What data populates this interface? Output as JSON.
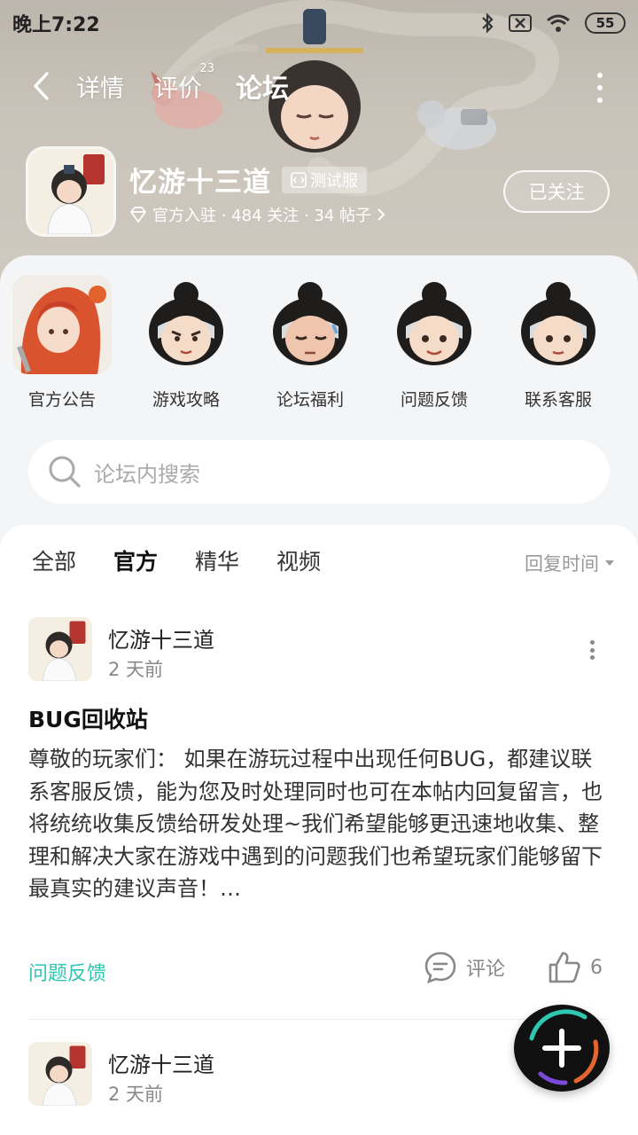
{
  "status": {
    "time": "晚上7:22",
    "battery": "55"
  },
  "nav": {
    "tabs": [
      {
        "label": "详情"
      },
      {
        "label": "评价",
        "badge": "23"
      },
      {
        "label": "论坛"
      }
    ]
  },
  "app": {
    "title": "忆游十三道",
    "test_badge": "测试服",
    "meta": "官方入驻 · 484 关注 · 34 帖子",
    "follow_label": "已关注"
  },
  "shortcuts": [
    {
      "label": "官方公告"
    },
    {
      "label": "游戏攻略"
    },
    {
      "label": "论坛福利"
    },
    {
      "label": "问题反馈"
    },
    {
      "label": "联系客服"
    }
  ],
  "search": {
    "placeholder": "论坛内搜索"
  },
  "filters": [
    "全部",
    "官方",
    "精华",
    "视频"
  ],
  "sort_label": "回复时间",
  "posts": [
    {
      "author": "忆游十三道",
      "time": "2 天前",
      "title": "BUG回收站",
      "body": "尊敬的玩家们： 如果在游玩过程中出现任何BUG，都建议联系客服反馈，能为您及时处理同时也可在本帖内回复留言，也将统统收集反馈给研发处理~我们希望能够更迅速地收集、整理和解决大家在游戏中遇到的问题我们也希望玩家们能够留下最真实的建议声音！…",
      "tag": "问题反馈",
      "comment_label": "评论",
      "likes": "6"
    },
    {
      "author": "忆游十三道",
      "time": "2 天前"
    }
  ],
  "colors": {
    "accent": "#2fc6b2"
  }
}
